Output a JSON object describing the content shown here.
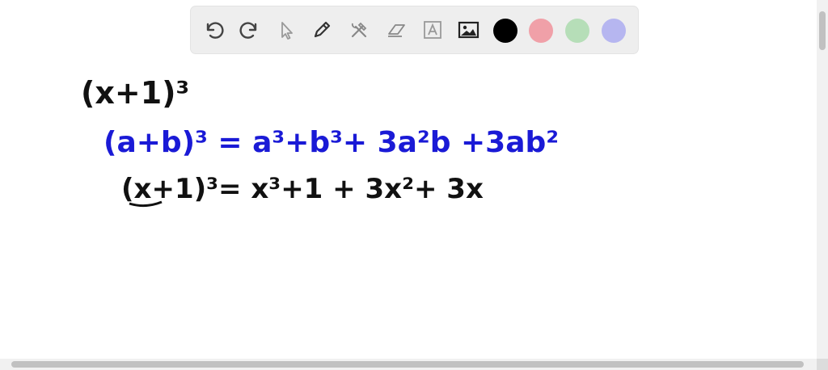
{
  "toolbar": {
    "tools": [
      {
        "name": "undo-icon"
      },
      {
        "name": "redo-icon"
      },
      {
        "name": "select-arrow-icon"
      },
      {
        "name": "pen-icon"
      },
      {
        "name": "tools-icon"
      },
      {
        "name": "eraser-icon"
      },
      {
        "name": "text-box-icon"
      },
      {
        "name": "image-icon"
      }
    ],
    "colors": [
      "#000000",
      "#f0a0a8",
      "#b6deb8",
      "#b6b6f0"
    ],
    "selected_color": "#000000"
  },
  "whiteboard": {
    "line1": "(x+1)³",
    "line2": "(a+b)³ =  a³+b³+  3a²b  +3ab²",
    "line3": "(x+1)³=  x³+1 + 3x²+ 3x",
    "ink_black": "#111111",
    "ink_blue": "#1a1ad6"
  }
}
